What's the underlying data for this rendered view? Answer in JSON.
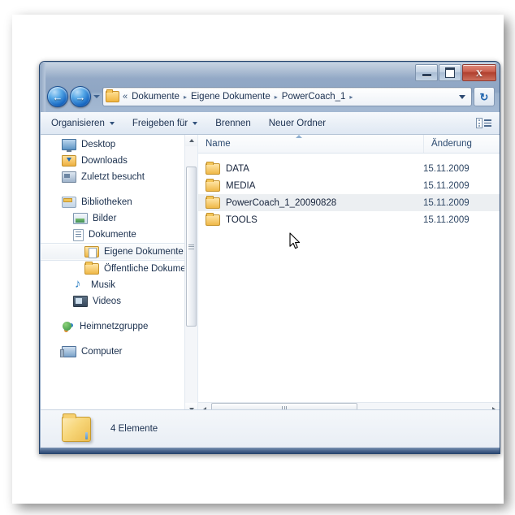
{
  "window": {
    "controls": {
      "minimize": "Minimieren",
      "maximize": "Maximieren",
      "close": "Schließen",
      "close_glyph": "X"
    }
  },
  "navigation": {
    "back_label": "Zurück",
    "back_glyph": "←",
    "forward_label": "Vorwärts",
    "forward_glyph": "→",
    "history_dropdown_label": "Zuletzt besuchte Seiten",
    "refresh_label": "Aktualisieren",
    "refresh_glyph": "↻"
  },
  "address_bar": {
    "overflow_glyph": "«",
    "crumbs": [
      {
        "label": "Dokumente"
      },
      {
        "label": "Eigene Dokumente"
      },
      {
        "label": "PowerCoach_1"
      }
    ],
    "separator": "▸",
    "dropdown_label": "Adressliste anzeigen"
  },
  "toolbar": {
    "items": [
      {
        "label": "Organisieren",
        "has_caret": true
      },
      {
        "label": "Freigeben für",
        "has_caret": true
      },
      {
        "label": "Brennen",
        "has_caret": false
      },
      {
        "label": "Neuer Ordner",
        "has_caret": false
      }
    ],
    "view_button_label": "Ansicht ändern"
  },
  "sidebar": {
    "items": [
      {
        "label": "Desktop",
        "icon": "monitor-icon",
        "indent": 0,
        "selected": false
      },
      {
        "label": "Downloads",
        "icon": "downloads-folder-icon",
        "indent": 0,
        "selected": false
      },
      {
        "label": "Zuletzt besucht",
        "icon": "recent-places-icon",
        "indent": 0,
        "selected": false
      },
      {
        "label": "Bibliotheken",
        "icon": "libraries-icon",
        "indent": 0,
        "selected": false
      },
      {
        "label": "Bilder",
        "icon": "pictures-icon",
        "indent": 1,
        "selected": false
      },
      {
        "label": "Dokumente",
        "icon": "documents-icon",
        "indent": 1,
        "selected": false
      },
      {
        "label": "Eigene Dokumente",
        "icon": "my-documents-icon",
        "indent": 2,
        "selected": true
      },
      {
        "label": "Öffentliche Dokumen",
        "icon": "public-documents-icon",
        "indent": 2,
        "selected": false
      },
      {
        "label": "Musik",
        "icon": "music-icon",
        "indent": 1,
        "selected": false
      },
      {
        "label": "Videos",
        "icon": "videos-icon",
        "indent": 1,
        "selected": false
      },
      {
        "label": "Heimnetzgruppe",
        "icon": "homegroup-icon",
        "indent": 0,
        "selected": false
      },
      {
        "label": "Computer",
        "icon": "computer-icon",
        "indent": 0,
        "selected": false
      }
    ],
    "scrollbar": {
      "up_label": "Nach oben scrollen",
      "down_label": "Nach unten scrollen"
    }
  },
  "file_list": {
    "columns": [
      {
        "label": "Name",
        "sorted": true,
        "sort_direction": "ascending"
      },
      {
        "label": "Änderung",
        "sorted": false,
        "sort_direction": ""
      }
    ],
    "rows": [
      {
        "name": "DATA",
        "date": "15.11.2009",
        "highlighted": false
      },
      {
        "name": "MEDIA",
        "date": "15.11.2009",
        "highlighted": false
      },
      {
        "name": "PowerCoach_1_20090828",
        "date": "15.11.2009",
        "highlighted": true
      },
      {
        "name": "TOOLS",
        "date": "15.11.2009",
        "highlighted": false
      }
    ],
    "hscrollbar": {
      "left_label": "Nach links scrollen",
      "right_label": "Nach rechts scrollen"
    }
  },
  "status_bar": {
    "text": "4 Elemente",
    "icon": "folder-icon"
  },
  "colors": {
    "glass": "#96acc8",
    "accent": "#1565c0",
    "close_red": "#b0402e",
    "folder_yellow": "#efb848",
    "selection": "#eceff2",
    "text": "#1b3050"
  }
}
